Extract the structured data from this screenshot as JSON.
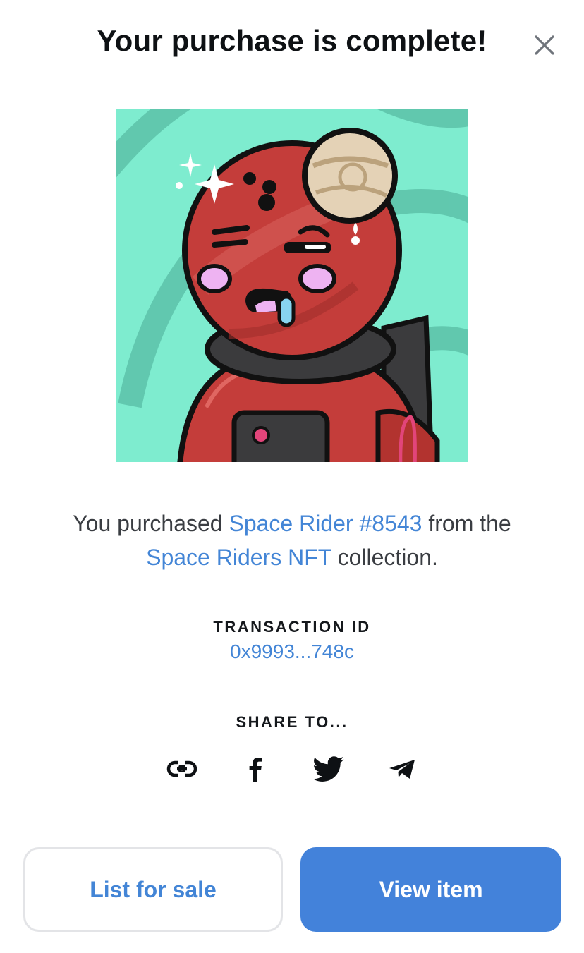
{
  "modal": {
    "title": "Your purchase is complete!"
  },
  "summary": {
    "prefix": "You purchased ",
    "item_name": "Space Rider #8543",
    "middle": " from the ",
    "collection_name": "Space Riders NFT",
    "suffix": " collection."
  },
  "transaction": {
    "label": "TRANSACTION ID",
    "value": "0x9993...748c"
  },
  "share": {
    "label": "SHARE TO...",
    "icons": [
      "link-icon",
      "facebook-icon",
      "twitter-icon",
      "telegram-icon"
    ]
  },
  "buttons": {
    "list_for_sale": "List for sale",
    "view_item": "View item"
  },
  "colors": {
    "accent": "#4385d6",
    "primary_button": "#4382da",
    "nft_background": "#7eeccf",
    "nft_suit": "#c43d3a"
  }
}
